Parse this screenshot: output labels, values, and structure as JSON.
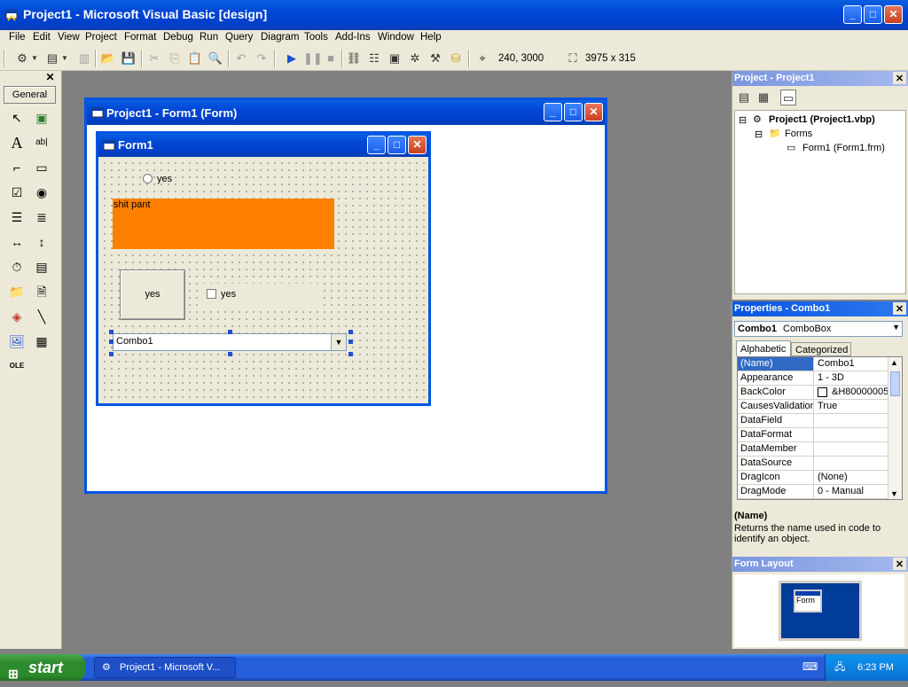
{
  "app": {
    "title": "Project1 - Microsoft Visual Basic [design]"
  },
  "menubar": [
    "File",
    "Edit",
    "View",
    "Project",
    "Format",
    "Debug",
    "Run",
    "Query",
    "Diagram",
    "Tools",
    "Add-Ins",
    "Window",
    "Help"
  ],
  "toolbar": {
    "position": "240, 3000",
    "size": "3975 x 315"
  },
  "toolbox": {
    "tab_label": "General",
    "close_glyph": "✕",
    "tools": [
      {
        "name": "pointer-icon",
        "glyph": "↖"
      },
      {
        "name": "picturebox-icon",
        "glyph": "▣"
      },
      {
        "name": "label-tool-icon",
        "glyph": "A"
      },
      {
        "name": "textbox-tool-icon",
        "glyph": "ab|"
      },
      {
        "name": "frame-tool-icon",
        "glyph": "⌐"
      },
      {
        "name": "commandbutton-tool-icon",
        "glyph": "▭"
      },
      {
        "name": "checkbox-tool-icon",
        "glyph": "☑"
      },
      {
        "name": "optionbutton-tool-icon",
        "glyph": "◉"
      },
      {
        "name": "combobox-tool-icon",
        "glyph": "☰"
      },
      {
        "name": "listbox-tool-icon",
        "glyph": "≣"
      },
      {
        "name": "hscroll-tool-icon",
        "glyph": "↔"
      },
      {
        "name": "vscroll-tool-icon",
        "glyph": "↕"
      },
      {
        "name": "timer-tool-icon",
        "glyph": "⏱"
      },
      {
        "name": "drivelist-tool-icon",
        "glyph": "▤"
      },
      {
        "name": "dirlist-tool-icon",
        "glyph": "📁"
      },
      {
        "name": "filelist-tool-icon",
        "glyph": "🗎"
      },
      {
        "name": "shape-tool-icon",
        "glyph": "◈"
      },
      {
        "name": "line-tool-icon",
        "glyph": "╲"
      },
      {
        "name": "image-tool-icon",
        "glyph": "🖼"
      },
      {
        "name": "data-tool-icon",
        "glyph": "▦"
      },
      {
        "name": "ole-tool-icon",
        "glyph": "OLE"
      }
    ]
  },
  "project_window": {
    "title": "Project1 - Form1 (Form)"
  },
  "form1": {
    "title": "Form1",
    "option_label": "yes",
    "label_text": "shit pant",
    "command_label": "yes",
    "check_label": "yes",
    "combo_text": "Combo1"
  },
  "project_explorer": {
    "title": "Project - Project1",
    "tree": {
      "project": "Project1 (Project1.vbp)",
      "folder": "Forms",
      "form": "Form1 (Form1.frm)"
    }
  },
  "properties": {
    "title": "Properties - Combo1",
    "object_name": "Combo1",
    "object_type": "ComboBox",
    "tabs": [
      "Alphabetic",
      "Categorized"
    ],
    "rows": [
      {
        "name": "(Name)",
        "value": "Combo1"
      },
      {
        "name": "Appearance",
        "value": "1 - 3D"
      },
      {
        "name": "BackColor",
        "value": "&H80000005"
      },
      {
        "name": "CausesValidation",
        "value": "True"
      },
      {
        "name": "DataField",
        "value": ""
      },
      {
        "name": "DataFormat",
        "value": ""
      },
      {
        "name": "DataMember",
        "value": ""
      },
      {
        "name": "DataSource",
        "value": ""
      },
      {
        "name": "DragIcon",
        "value": "(None)"
      },
      {
        "name": "DragMode",
        "value": "0 - Manual"
      }
    ],
    "desc_title": "(Name)",
    "desc_text": "Returns the name used in code to identify an object."
  },
  "form_layout": {
    "title": "Form Layout",
    "form_label": "Form"
  },
  "taskbar": {
    "start": "start",
    "task": "Project1 - Microsoft V...",
    "clock": "6:23 PM"
  }
}
